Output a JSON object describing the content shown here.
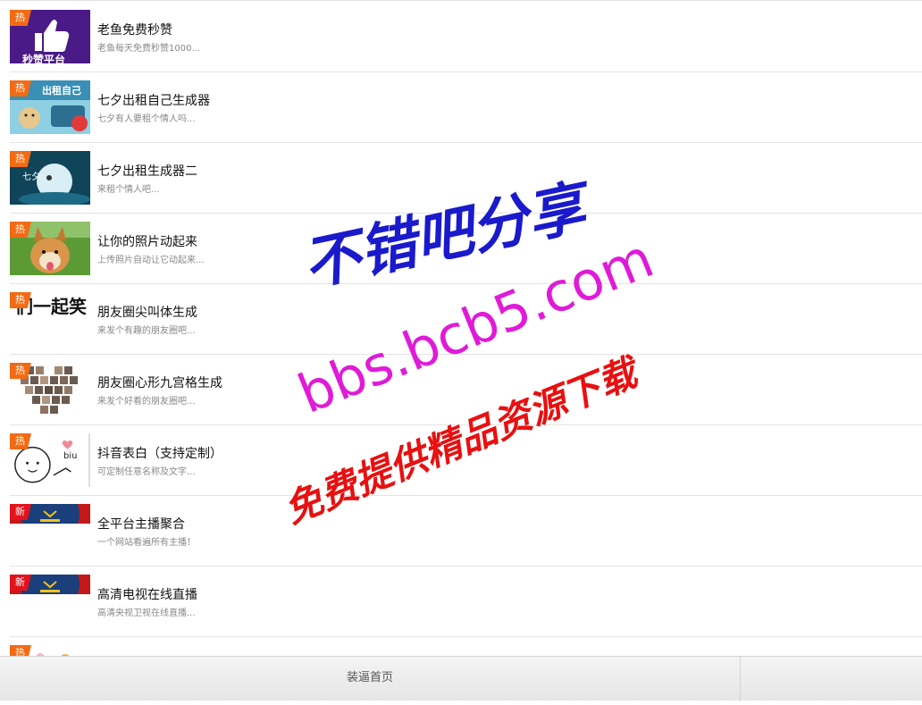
{
  "items": [
    {
      "title": "老鱼免费秒赞",
      "desc": "老鱼每天免费秒赞1000...",
      "badge": "热",
      "thumb_caption": "秒赞平台"
    },
    {
      "title": "七夕出租自己生成器",
      "desc": "七夕有人要租个情人吗...",
      "badge": "热",
      "thumb_caption": "出租自己"
    },
    {
      "title": "七夕出租生成器二",
      "desc": "来租个情人吧...",
      "badge": "热",
      "thumb_caption": "七夕"
    },
    {
      "title": "让你的照片动起来",
      "desc": "上传照片自动让它动起来...",
      "badge": "热",
      "thumb_caption": ""
    },
    {
      "title": "朋友圈尖叫体生成",
      "desc": "来发个有趣的朋友圈吧...",
      "badge": "热",
      "thumb_caption": "们一起笑"
    },
    {
      "title": "朋友圈心形九宫格生成",
      "desc": "来发个好看的朋友圈吧...",
      "badge": "热",
      "thumb_caption": ""
    },
    {
      "title": "抖音表白（支持定制）",
      "desc": "可定制任意名称及文字...",
      "badge": "热",
      "thumb_caption": "biu"
    },
    {
      "title": "全平台主播聚合",
      "desc": "一个网站看遍所有主播！",
      "badge": "新",
      "thumb_caption": ""
    },
    {
      "title": "高清电视在线直播",
      "desc": "高清央视卫视在线直播...",
      "badge": "新",
      "thumb_caption": ""
    },
    {
      "title": "",
      "desc": "",
      "badge": "热",
      "thumb_caption": ""
    }
  ],
  "watermark": {
    "line1": "不错吧分享",
    "line2": "bbs.bcb5.com",
    "line3": "免费提供精品资源下载",
    "color_blue": "#1a1acc",
    "color_magenta": "#e01ad8",
    "color_red": "#e81010"
  },
  "footer": {
    "home_label": "装逼首页"
  },
  "colors": {
    "badge_hot": "#f26b14",
    "badge_new": "#e3121c",
    "divider": "#e4e4e4"
  },
  "icons": {
    "thumb_1": "thumbs-up-icon",
    "thumb_2": "dog-poster-thumbnail",
    "thumb_3": "moon-poster-thumbnail",
    "thumb_4": "shiba-dog-photo",
    "thumb_5": "text-banner-thumbnail",
    "thumb_6": "heart-grid-thumbnail",
    "thumb_7": "cartoon-face-thumbnail",
    "thumb_8": "stage-curtain-thumbnail",
    "thumb_9": "stage-curtain-thumbnail"
  }
}
